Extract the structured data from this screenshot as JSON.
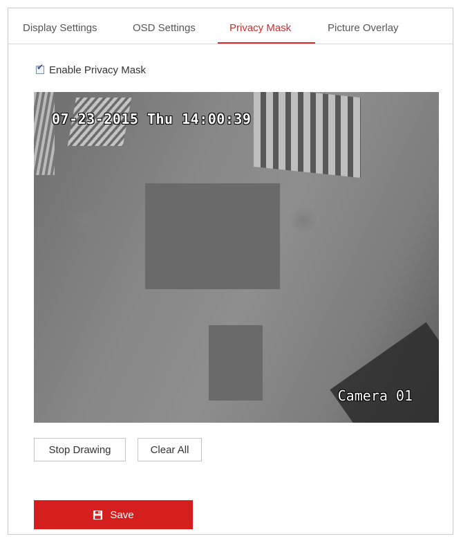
{
  "tabs": [
    {
      "label": "Display Settings",
      "active": false
    },
    {
      "label": "OSD Settings",
      "active": false
    },
    {
      "label": "Privacy Mask",
      "active": true
    },
    {
      "label": "Picture Overlay",
      "active": false
    }
  ],
  "enable": {
    "label": "Enable Privacy Mask",
    "checked": true
  },
  "video": {
    "osd_datetime": "07-23-2015 Thu 14:00:39",
    "camera_name": "Camera 01",
    "mask_count": 2
  },
  "buttons": {
    "stop_drawing": "Stop Drawing",
    "clear_all": "Clear All",
    "save": "Save"
  },
  "icons": {
    "save": "floppy-disk-icon",
    "checkbox": "check-icon"
  },
  "colors": {
    "accent": "#d12d2d",
    "save_bg": "#d51f1f",
    "mask": "#6a6a6a"
  }
}
